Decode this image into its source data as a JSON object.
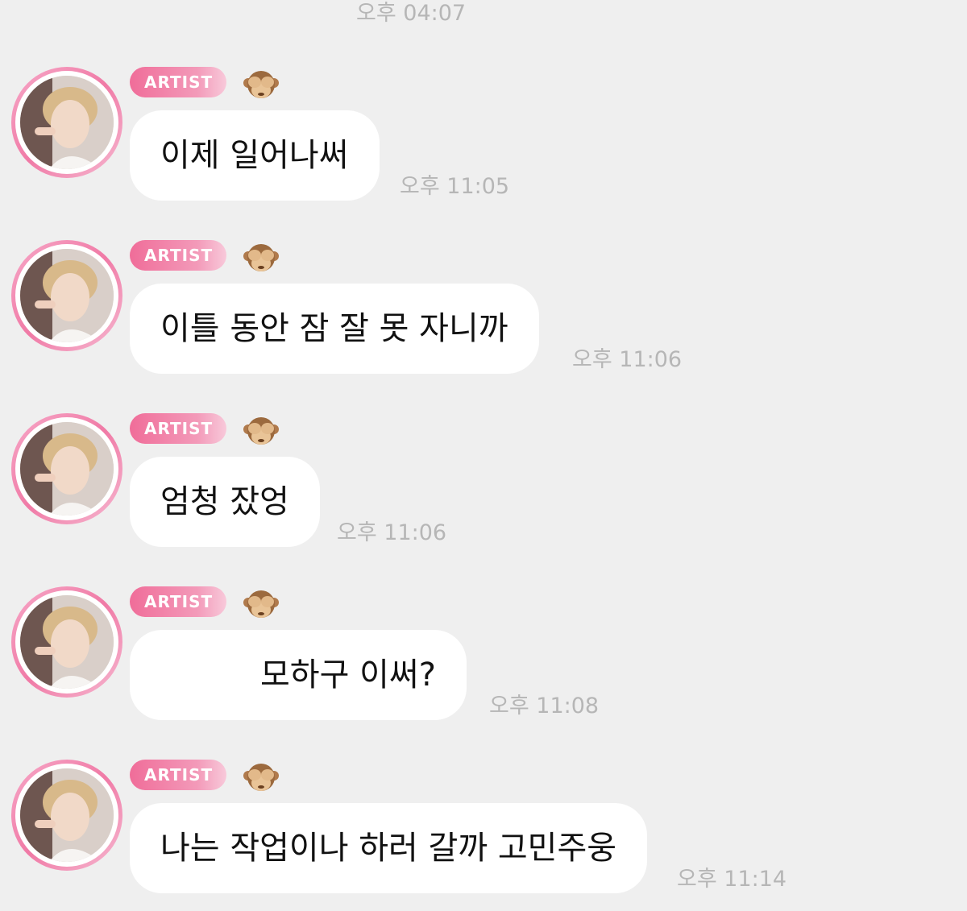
{
  "top_timestamp": "오후 04:07",
  "colors": {
    "background": "#efefef",
    "bubble": "#ffffff",
    "badge_pink": "#f06d99",
    "timestamp_gray": "#b6b6b6"
  },
  "messages": [
    {
      "badge": "ARTIST",
      "emoji_icon": "see-no-evil-monkey-icon",
      "text": "이제 일어나써",
      "time": "오후 11:05"
    },
    {
      "badge": "ARTIST",
      "emoji_icon": "see-no-evil-monkey-icon",
      "text": "이틀 동안 잠 잘 못 자니까",
      "time": "오후 11:06"
    },
    {
      "badge": "ARTIST",
      "emoji_icon": "see-no-evil-monkey-icon",
      "text": "엄청 잤엉",
      "time": "오후 11:06"
    },
    {
      "badge": "ARTIST",
      "emoji_icon": "see-no-evil-monkey-icon",
      "text": "모하구 이써?",
      "time": "오후 11:08"
    },
    {
      "badge": "ARTIST",
      "emoji_icon": "see-no-evil-monkey-icon",
      "text": "나는 작업이나 하러 갈까 고민주웅",
      "time": "오후 11:14"
    }
  ]
}
